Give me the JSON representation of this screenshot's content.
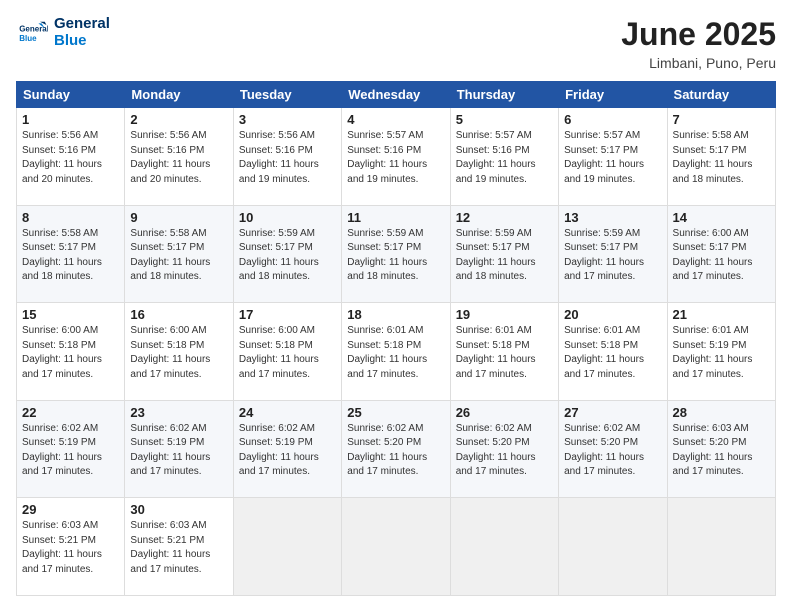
{
  "header": {
    "logo_general": "General",
    "logo_blue": "Blue",
    "month_title": "June 2025",
    "location": "Limbani, Puno, Peru"
  },
  "weekdays": [
    "Sunday",
    "Monday",
    "Tuesday",
    "Wednesday",
    "Thursday",
    "Friday",
    "Saturday"
  ],
  "weeks": [
    [
      {
        "day": "1",
        "text": "Sunrise: 5:56 AM\nSunset: 5:16 PM\nDaylight: 11 hours\nand 20 minutes."
      },
      {
        "day": "2",
        "text": "Sunrise: 5:56 AM\nSunset: 5:16 PM\nDaylight: 11 hours\nand 20 minutes."
      },
      {
        "day": "3",
        "text": "Sunrise: 5:56 AM\nSunset: 5:16 PM\nDaylight: 11 hours\nand 19 minutes."
      },
      {
        "day": "4",
        "text": "Sunrise: 5:57 AM\nSunset: 5:16 PM\nDaylight: 11 hours\nand 19 minutes."
      },
      {
        "day": "5",
        "text": "Sunrise: 5:57 AM\nSunset: 5:16 PM\nDaylight: 11 hours\nand 19 minutes."
      },
      {
        "day": "6",
        "text": "Sunrise: 5:57 AM\nSunset: 5:17 PM\nDaylight: 11 hours\nand 19 minutes."
      },
      {
        "day": "7",
        "text": "Sunrise: 5:58 AM\nSunset: 5:17 PM\nDaylight: 11 hours\nand 18 minutes."
      }
    ],
    [
      {
        "day": "8",
        "text": "Sunrise: 5:58 AM\nSunset: 5:17 PM\nDaylight: 11 hours\nand 18 minutes."
      },
      {
        "day": "9",
        "text": "Sunrise: 5:58 AM\nSunset: 5:17 PM\nDaylight: 11 hours\nand 18 minutes."
      },
      {
        "day": "10",
        "text": "Sunrise: 5:59 AM\nSunset: 5:17 PM\nDaylight: 11 hours\nand 18 minutes."
      },
      {
        "day": "11",
        "text": "Sunrise: 5:59 AM\nSunset: 5:17 PM\nDaylight: 11 hours\nand 18 minutes."
      },
      {
        "day": "12",
        "text": "Sunrise: 5:59 AM\nSunset: 5:17 PM\nDaylight: 11 hours\nand 18 minutes."
      },
      {
        "day": "13",
        "text": "Sunrise: 5:59 AM\nSunset: 5:17 PM\nDaylight: 11 hours\nand 17 minutes."
      },
      {
        "day": "14",
        "text": "Sunrise: 6:00 AM\nSunset: 5:17 PM\nDaylight: 11 hours\nand 17 minutes."
      }
    ],
    [
      {
        "day": "15",
        "text": "Sunrise: 6:00 AM\nSunset: 5:18 PM\nDaylight: 11 hours\nand 17 minutes."
      },
      {
        "day": "16",
        "text": "Sunrise: 6:00 AM\nSunset: 5:18 PM\nDaylight: 11 hours\nand 17 minutes."
      },
      {
        "day": "17",
        "text": "Sunrise: 6:00 AM\nSunset: 5:18 PM\nDaylight: 11 hours\nand 17 minutes."
      },
      {
        "day": "18",
        "text": "Sunrise: 6:01 AM\nSunset: 5:18 PM\nDaylight: 11 hours\nand 17 minutes."
      },
      {
        "day": "19",
        "text": "Sunrise: 6:01 AM\nSunset: 5:18 PM\nDaylight: 11 hours\nand 17 minutes."
      },
      {
        "day": "20",
        "text": "Sunrise: 6:01 AM\nSunset: 5:18 PM\nDaylight: 11 hours\nand 17 minutes."
      },
      {
        "day": "21",
        "text": "Sunrise: 6:01 AM\nSunset: 5:19 PM\nDaylight: 11 hours\nand 17 minutes."
      }
    ],
    [
      {
        "day": "22",
        "text": "Sunrise: 6:02 AM\nSunset: 5:19 PM\nDaylight: 11 hours\nand 17 minutes."
      },
      {
        "day": "23",
        "text": "Sunrise: 6:02 AM\nSunset: 5:19 PM\nDaylight: 11 hours\nand 17 minutes."
      },
      {
        "day": "24",
        "text": "Sunrise: 6:02 AM\nSunset: 5:19 PM\nDaylight: 11 hours\nand 17 minutes."
      },
      {
        "day": "25",
        "text": "Sunrise: 6:02 AM\nSunset: 5:20 PM\nDaylight: 11 hours\nand 17 minutes."
      },
      {
        "day": "26",
        "text": "Sunrise: 6:02 AM\nSunset: 5:20 PM\nDaylight: 11 hours\nand 17 minutes."
      },
      {
        "day": "27",
        "text": "Sunrise: 6:02 AM\nSunset: 5:20 PM\nDaylight: 11 hours\nand 17 minutes."
      },
      {
        "day": "28",
        "text": "Sunrise: 6:03 AM\nSunset: 5:20 PM\nDaylight: 11 hours\nand 17 minutes."
      }
    ],
    [
      {
        "day": "29",
        "text": "Sunrise: 6:03 AM\nSunset: 5:21 PM\nDaylight: 11 hours\nand 17 minutes."
      },
      {
        "day": "30",
        "text": "Sunrise: 6:03 AM\nSunset: 5:21 PM\nDaylight: 11 hours\nand 17 minutes."
      },
      {
        "day": "",
        "text": ""
      },
      {
        "day": "",
        "text": ""
      },
      {
        "day": "",
        "text": ""
      },
      {
        "day": "",
        "text": ""
      },
      {
        "day": "",
        "text": ""
      }
    ]
  ]
}
